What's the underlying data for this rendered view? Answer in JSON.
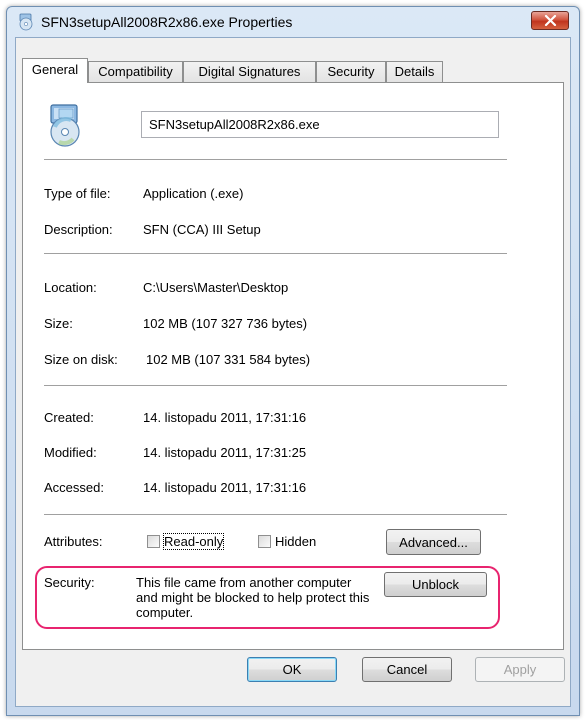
{
  "window": {
    "title": "SFN3setupAll2008R2x86.exe Properties"
  },
  "tabs": [
    "General",
    "Compatibility",
    "Digital Signatures",
    "Security",
    "Details"
  ],
  "general": {
    "file_name": "SFN3setupAll2008R2x86.exe",
    "type_label": "Type of file:",
    "type_value": "Application (.exe)",
    "description_label": "Description:",
    "description_value": "SFN (CCA) III Setup",
    "location_label": "Location:",
    "location_value": "C:\\Users\\Master\\Desktop",
    "size_label": "Size:",
    "size_value": "102 MB (107 327 736 bytes)",
    "size_on_disk_label": "Size on disk:",
    "size_on_disk_value": "102 MB (107 331 584 bytes)",
    "created_label": "Created:",
    "created_value": "14. listopadu 2011, 17:31:16",
    "modified_label": "Modified:",
    "modified_value": "14. listopadu 2011, 17:31:25",
    "accessed_label": "Accessed:",
    "accessed_value": "14. listopadu 2011, 17:31:16",
    "attributes_label": "Attributes:",
    "readonly_label": "Read-only",
    "readonly_checked": false,
    "hidden_label": "Hidden",
    "hidden_checked": false,
    "advanced_label": "Advanced...",
    "security_label": "Security:",
    "security_text": "This file came from another computer and might be blocked to help protect this computer.",
    "unblock_label": "Unblock"
  },
  "buttons": {
    "ok": "OK",
    "cancel": "Cancel",
    "apply": "Apply"
  },
  "colors": {
    "highlight": "#e8246f",
    "close_button": "#c7412a"
  },
  "icons": {
    "title": "setup-cd-icon",
    "file": "setup-cd-icon",
    "close": "close-icon"
  }
}
